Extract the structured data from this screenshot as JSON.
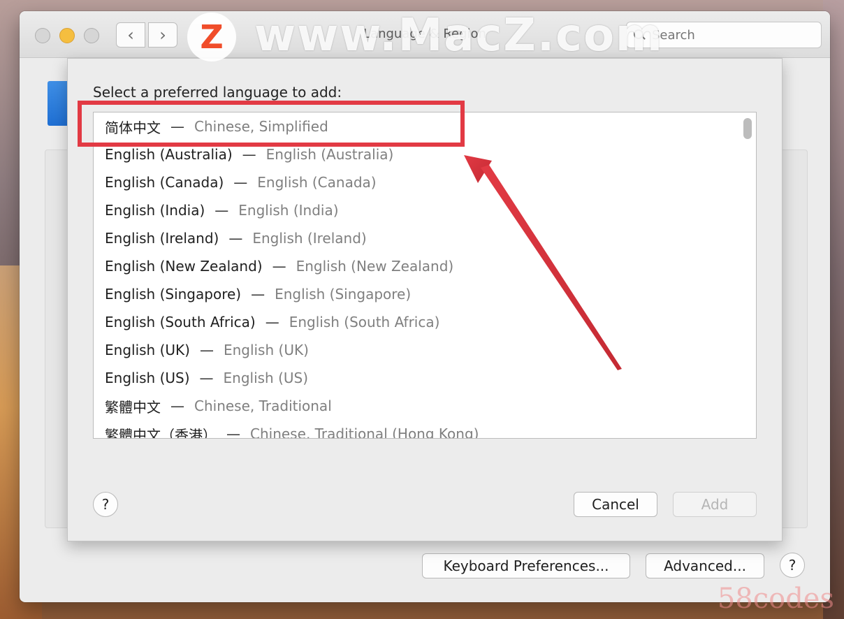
{
  "window": {
    "title": "Language & Region",
    "back_glyph": "‹",
    "forward_glyph": "›",
    "search_placeholder": "Search"
  },
  "sheet": {
    "prompt": "Select a preferred language to add:",
    "languages": [
      {
        "native": "简体中文",
        "english": "Chinese, Simplified"
      },
      {
        "native": "English (Australia)",
        "english": "English (Australia)"
      },
      {
        "native": "English (Canada)",
        "english": "English (Canada)"
      },
      {
        "native": "English (India)",
        "english": "English (India)"
      },
      {
        "native": "English (Ireland)",
        "english": "English (Ireland)"
      },
      {
        "native": "English (New Zealand)",
        "english": "English (New Zealand)"
      },
      {
        "native": "English (Singapore)",
        "english": "English (Singapore)"
      },
      {
        "native": "English (South Africa)",
        "english": "English (South Africa)"
      },
      {
        "native": "English (UK)",
        "english": "English (UK)"
      },
      {
        "native": "English (US)",
        "english": "English (US)"
      },
      {
        "native": "繁體中文",
        "english": "Chinese, Traditional"
      },
      {
        "native": "繁體中文（香港）",
        "english": "Chinese, Traditional (Hong Kong)"
      }
    ],
    "separator": "—",
    "help_label": "?",
    "cancel_label": "Cancel",
    "add_label": "Add"
  },
  "bottom": {
    "keyboard_label": "Keyboard Preferences...",
    "advanced_label": "Advanced...",
    "help_label": "?"
  },
  "watermark": {
    "logo": "Z",
    "text": "www.MacZ.com",
    "site": "58codes"
  },
  "colors": {
    "highlight": "#e23a44",
    "minimize": "#f5be3f"
  }
}
